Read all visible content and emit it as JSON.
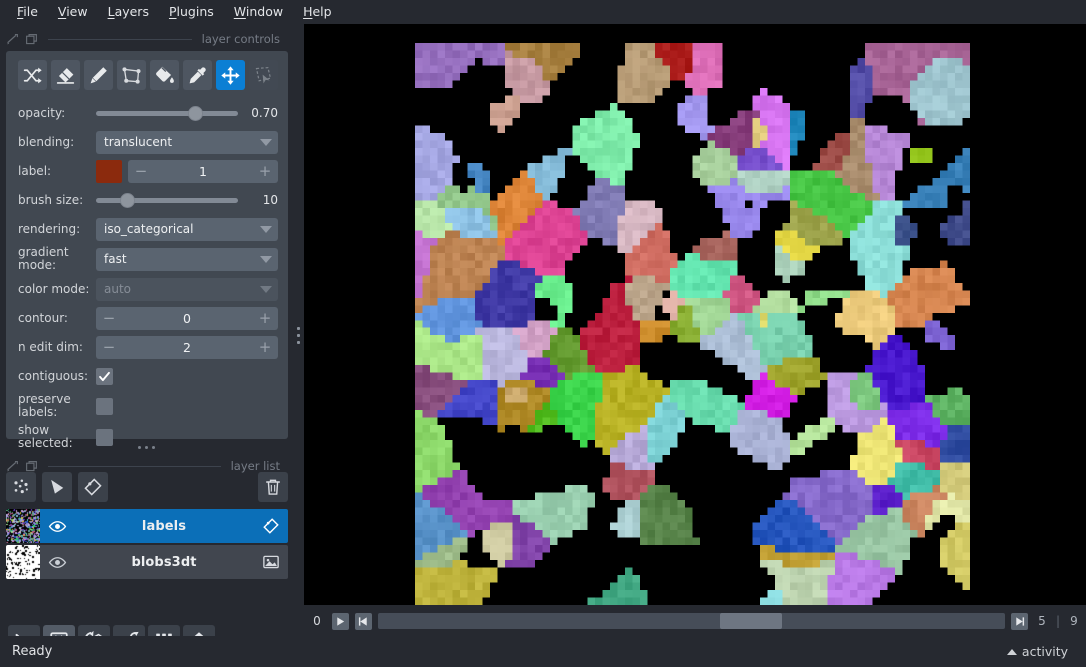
{
  "menu": {
    "items": [
      {
        "label": "File",
        "mnemonic": "F"
      },
      {
        "label": "View",
        "mnemonic": "V"
      },
      {
        "label": "Layers",
        "mnemonic": "L"
      },
      {
        "label": "Plugins",
        "mnemonic": "P"
      },
      {
        "label": "Window",
        "mnemonic": "W"
      },
      {
        "label": "Help",
        "mnemonic": "H"
      }
    ]
  },
  "docks": {
    "layer_controls_title": "layer controls",
    "layer_list_title": "layer list"
  },
  "layer_controls": {
    "tools": [
      {
        "name": "shuffle-colors-tool",
        "title": "shuffle colors",
        "state": "enabled"
      },
      {
        "name": "eraser-tool",
        "title": "erase",
        "state": "enabled"
      },
      {
        "name": "paint-brush-tool",
        "title": "paint",
        "state": "enabled"
      },
      {
        "name": "polygon-tool",
        "title": "polygon",
        "state": "enabled"
      },
      {
        "name": "fill-bucket-tool",
        "title": "fill",
        "state": "enabled"
      },
      {
        "name": "color-picker-tool",
        "title": "pick color",
        "state": "enabled"
      },
      {
        "name": "pan-zoom-tool",
        "title": "pan/zoom",
        "state": "active"
      },
      {
        "name": "transform-tool",
        "title": "transform",
        "state": "disabled"
      }
    ],
    "opacity": {
      "label": "opacity:",
      "value": "0.70",
      "fraction": 0.7
    },
    "blending": {
      "label": "blending:",
      "value": "translucent"
    },
    "label": {
      "label": "label:",
      "value": "1",
      "swatch_color": "#8b2a0d"
    },
    "brush_size": {
      "label": "brush size:",
      "value": "10",
      "fraction": 0.2
    },
    "rendering": {
      "label": "rendering:",
      "value": "iso_categorical"
    },
    "gradient_mode": {
      "label": "gradient mode:",
      "value": "fast"
    },
    "color_mode": {
      "label": "color mode:",
      "value": "auto",
      "disabled": true
    },
    "contour": {
      "label": "contour:",
      "value": "0"
    },
    "n_edit_dim": {
      "label": "n edit dim:",
      "value": "2"
    },
    "contiguous": {
      "label": "contiguous:",
      "checked": true
    },
    "preserve_labels": {
      "label": "preserve labels:",
      "checked": false
    },
    "show_selected": {
      "label": "show selected:",
      "checked": false
    }
  },
  "layer_list": {
    "buttons": [
      {
        "name": "new-points-button",
        "title": "New points layer"
      },
      {
        "name": "new-shapes-button",
        "title": "New shapes layer"
      },
      {
        "name": "new-labels-button",
        "title": "New labels layer"
      },
      {
        "name": "delete-layer-button",
        "title": "Delete selected layer"
      }
    ],
    "layers": [
      {
        "name": "labels",
        "type": "labels",
        "visible": true,
        "selected": true
      },
      {
        "name": "blobs3dt",
        "type": "image",
        "visible": true,
        "selected": false
      }
    ]
  },
  "viewer_buttons": [
    {
      "name": "console-button",
      "title": "Open IPython console",
      "active": false
    },
    {
      "name": "ndisplay-button",
      "title": "Toggle 2D/3D view",
      "active": true
    },
    {
      "name": "roll-dims-button",
      "title": "Roll dimensions",
      "active": false
    },
    {
      "name": "transpose-button",
      "title": "Transpose dimensions",
      "active": false
    },
    {
      "name": "grid-view-button",
      "title": "Toggle grid view",
      "active": false
    },
    {
      "name": "home-button",
      "title": "Reset view",
      "active": false
    }
  ],
  "dims": {
    "axis_label": "0",
    "current": "5",
    "separator": "|",
    "max": "9",
    "play_title": "play",
    "last_frame_title": "last frame"
  },
  "status": {
    "text": "Ready",
    "activity_label": "activity"
  },
  "theme": {
    "background": "#262930",
    "panel": "#414851",
    "accent": "#0b7fd4",
    "selection": "#0b6fb8",
    "canvas": "#000000",
    "text": "#d5d7da",
    "muted_text": "#767c86"
  }
}
